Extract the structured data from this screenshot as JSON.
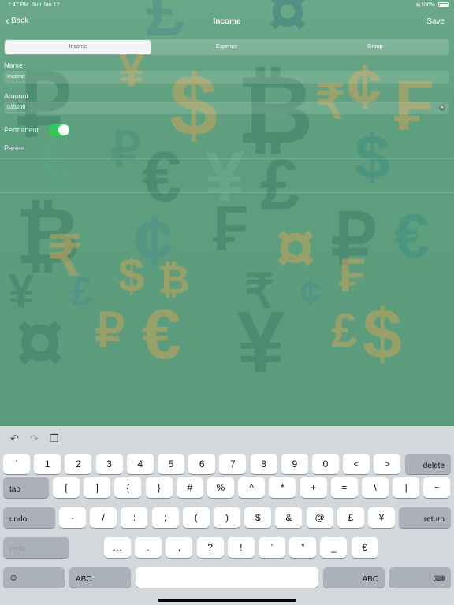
{
  "status": {
    "time": "1:47 PM",
    "date": "Sun Jan 12",
    "battery": "100%"
  },
  "nav": {
    "back": "Back",
    "title": "Income",
    "save": "Save"
  },
  "segments": [
    "Income",
    "Expence",
    "Group"
  ],
  "form": {
    "name_label": "Name",
    "name_value": "Income",
    "amount_label": "Amount",
    "amount_value": "015000",
    "permanent_label": "Permanent",
    "permanent_on": true,
    "parent_label": "Parent"
  },
  "background_glyphs": [
    "₽",
    "€",
    "¥",
    "£",
    "$",
    "₿",
    "₹",
    "¢",
    "₣",
    "¤"
  ],
  "keyboard": {
    "row1": [
      "`",
      "1",
      "2",
      "3",
      "4",
      "5",
      "6",
      "7",
      "8",
      "9",
      "0",
      "<",
      ">"
    ],
    "delete": "delete",
    "tab": "tab",
    "row2": [
      "[",
      "]",
      "{",
      "}",
      "#",
      "%",
      "^",
      "*",
      "+",
      "=",
      "\\",
      "|",
      "~"
    ],
    "undo": "undo",
    "row3": [
      "-",
      "/",
      ":",
      ";",
      "(",
      ")",
      "$",
      "&",
      "@",
      "£",
      "¥"
    ],
    "return": "return",
    "redo": "redo",
    "row4": [
      "…",
      ".",
      ",",
      "?",
      "!",
      "’",
      "”",
      "_",
      "€"
    ],
    "abc": "ABC",
    "emoji": "☺",
    "hide": "⌨"
  },
  "colors": {
    "accent": "#34c759",
    "background": "#5e9f7f",
    "keyboard": "#d3d8dd"
  }
}
